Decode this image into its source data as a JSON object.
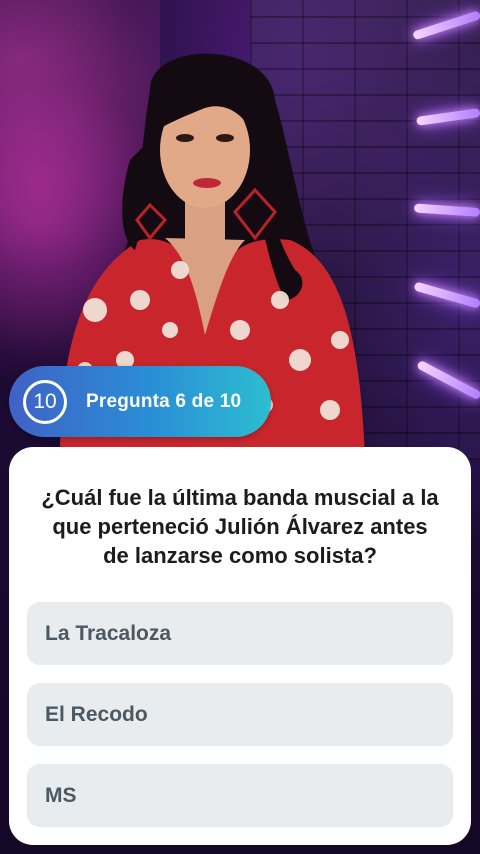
{
  "quiz": {
    "timer_value": "10",
    "question_counter": "Pregunta 6 de 10",
    "question": "¿Cuál fue la última banda muscial a la que perteneció Julión Álvarez antes de lanzarse como solista?",
    "options": [
      {
        "label": "La Tracaloza"
      },
      {
        "label": "El Recodo"
      },
      {
        "label": "MS"
      }
    ]
  },
  "colors": {
    "pill_gradient_start": "#3f62c6",
    "pill_gradient_end": "#2dbdd0",
    "card_background": "#ffffff",
    "option_background": "#e8ecef",
    "option_text": "#4c5962",
    "question_text": "#1c1c1c"
  }
}
